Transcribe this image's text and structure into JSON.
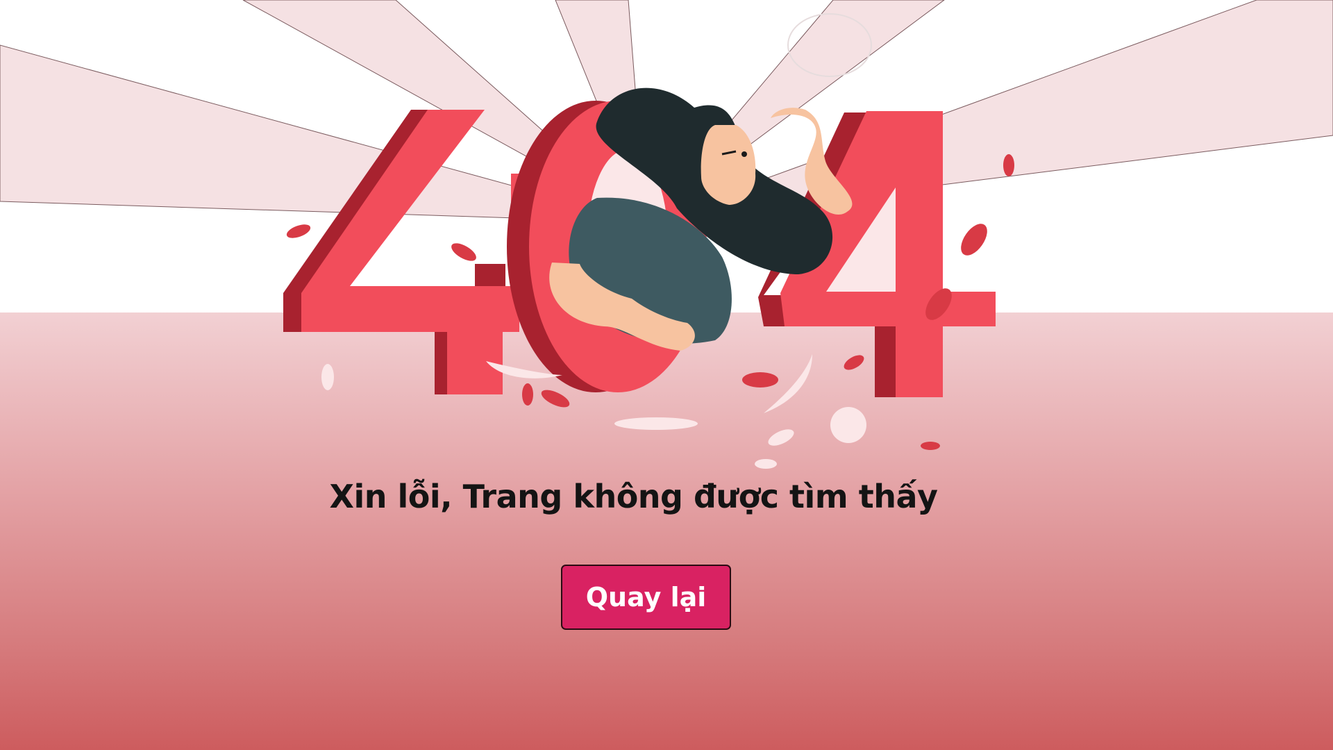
{
  "illustration": {
    "digits": [
      "4",
      "0",
      "4"
    ],
    "digit_color": "#f24d5b",
    "digit_shade_color": "#a8222f",
    "hair_color": "#1f2b2e",
    "shirt_color": "#3e5a61",
    "skin_color": "#f7c3a0"
  },
  "error": {
    "message": "Xin lỗi, Trang không được tìm thấy"
  },
  "back_button": {
    "label": "Quay lại",
    "color": "#d92262"
  },
  "background": {
    "top_color": "#ffffff",
    "gradient_start": "#f2d0d3",
    "gradient_end": "#cd5c5e"
  }
}
